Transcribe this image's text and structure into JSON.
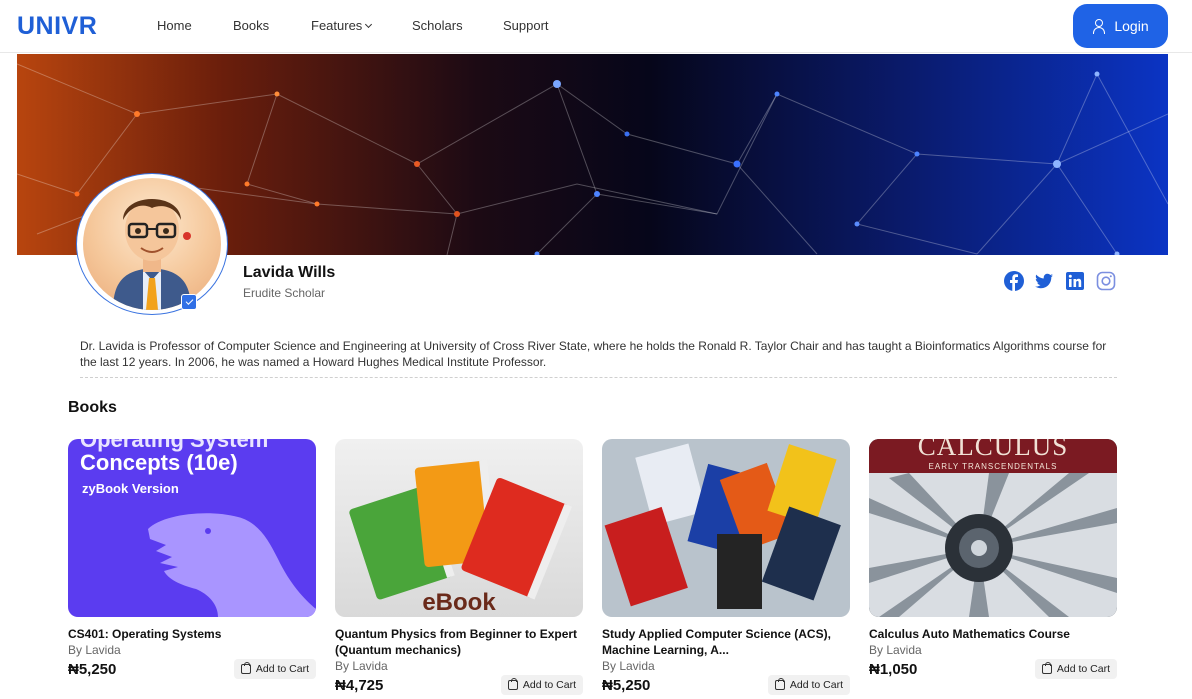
{
  "nav": {
    "logo": "UNIVR",
    "links": [
      "Home",
      "Books",
      "Features",
      "Scholars",
      "Support"
    ],
    "login_label": "Login"
  },
  "profile": {
    "name": "Lavida Wills",
    "title": "Erudite Scholar",
    "bio": "Dr. Lavida is Professor of Computer Science and Engineering at University of Cross River State, where he holds the Ronald R. Taylor Chair and has taught a Bioinformatics Algorithms course for the last 12 years. In 2006, he was named a Howard Hughes Medical Institute Professor.",
    "social": [
      "facebook-icon",
      "twitter-icon",
      "linkedin-icon",
      "instagram-icon"
    ]
  },
  "books_section": {
    "title": "Books",
    "cart_label": "Add to Cart",
    "items": [
      {
        "title": "CS401: Operating Systems",
        "author": "By Lavida",
        "price": "₦5,250",
        "cover_lines": [
          "Operating System",
          "Concepts (10e)",
          "zyBook Version"
        ]
      },
      {
        "title": "Quantum Physics from Beginner to Expert (Quantum mechanics)",
        "author": "By Lavida",
        "price": "₦4,725",
        "cover_lines": [
          "eBook"
        ]
      },
      {
        "title": "Study Applied Computer Science (ACS), Machine Learning, A...",
        "author": "By Lavida",
        "price": "₦5,250",
        "cover_lines": []
      },
      {
        "title": "Calculus Auto Mathematics Course",
        "author": "By Lavida",
        "price": "₦1,050",
        "cover_lines": [
          "CALCULUS",
          "EARLY TRANSCENDENTALS"
        ]
      }
    ]
  },
  "colors": {
    "brand": "#1f5fd6",
    "button": "#1f63e6"
  }
}
